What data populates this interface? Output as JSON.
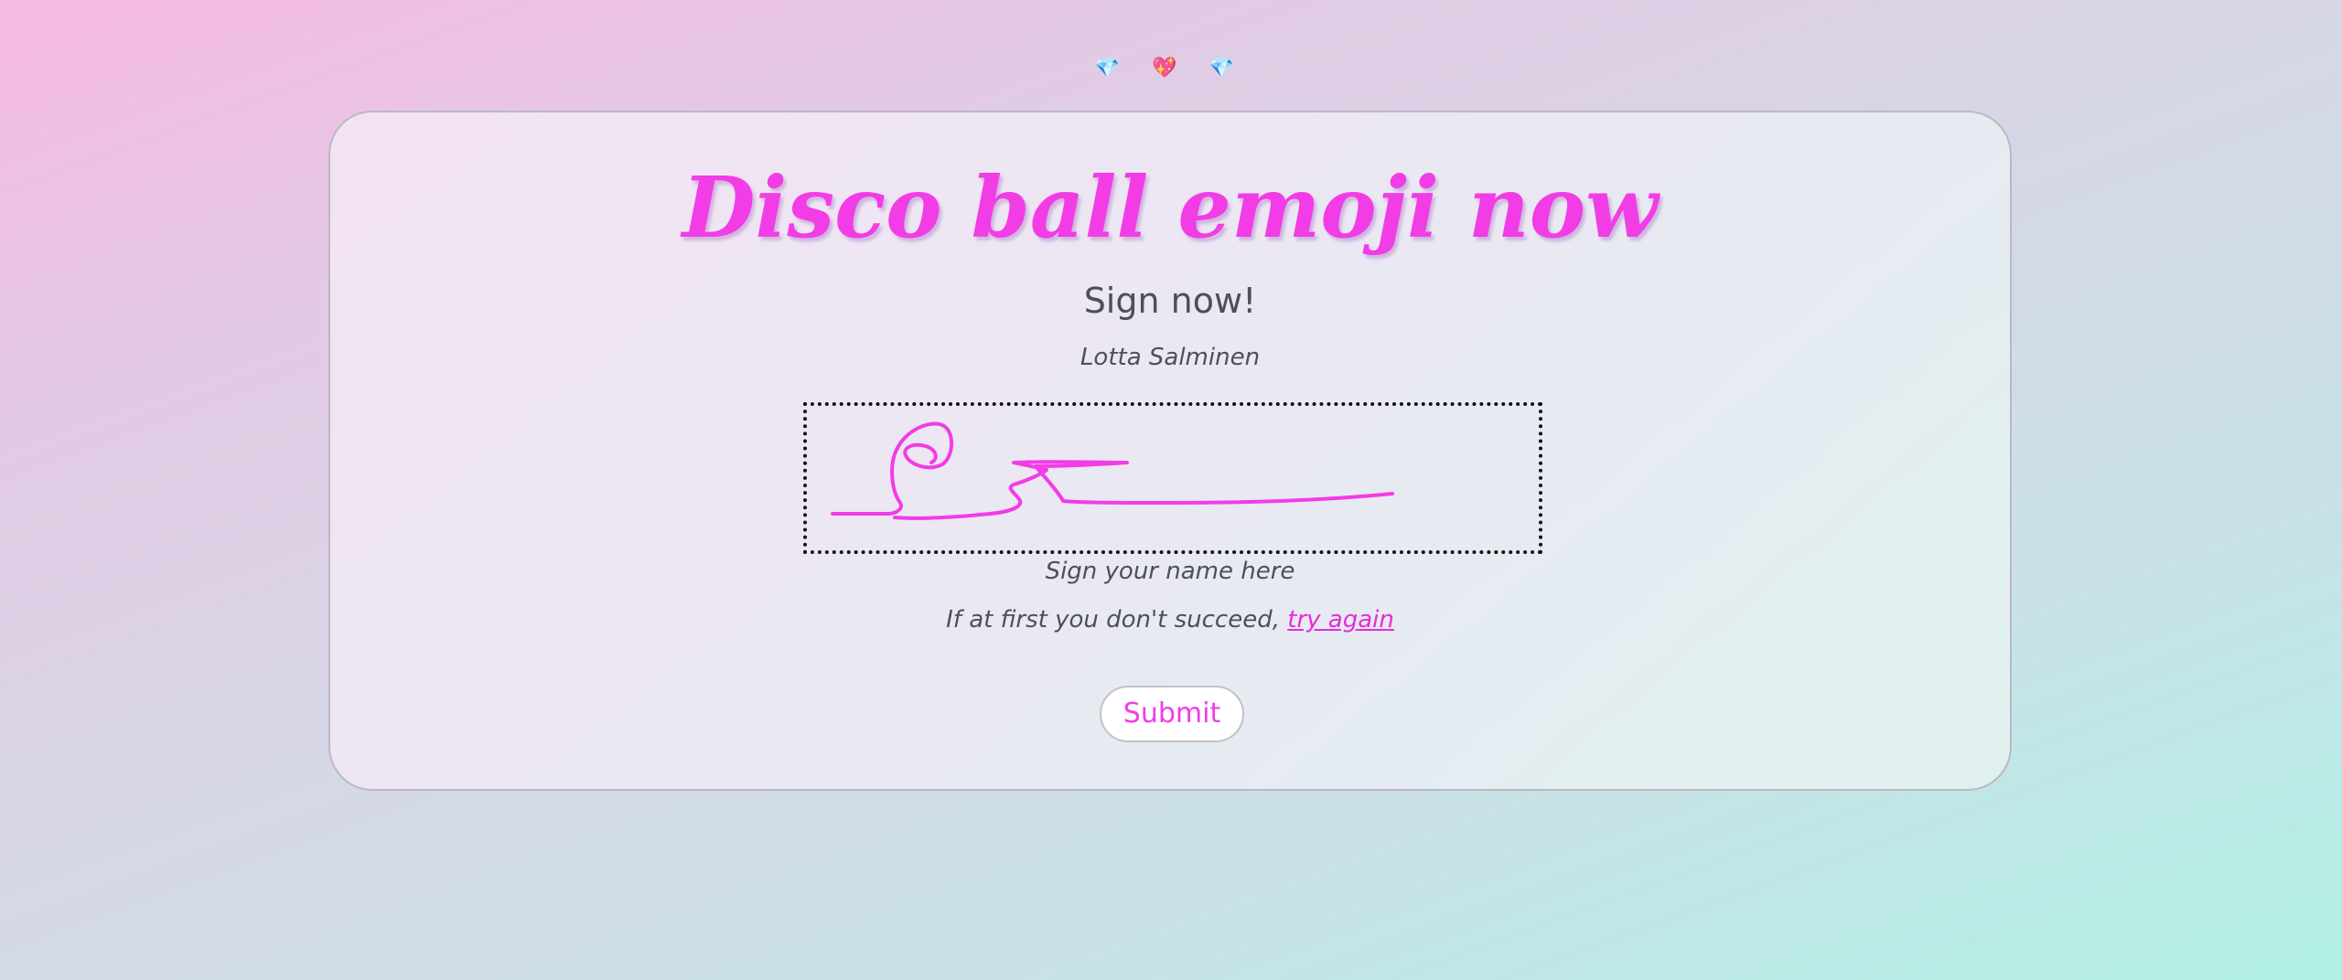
{
  "decor": {
    "emojis": [
      "💎",
      "💖",
      "💎"
    ]
  },
  "card": {
    "title": "Disco ball emoji now",
    "subtitle": "Sign now!",
    "signer_name": "Lotta Salminen",
    "signature_hint": "Sign your name here",
    "retry_text": "If at first you don't succeed,",
    "retry_link": "try again",
    "submit_label": "Submit"
  },
  "colors": {
    "accent": "#f23ce6",
    "text": "#4d5058",
    "signature_ink": "#f23ce6"
  }
}
